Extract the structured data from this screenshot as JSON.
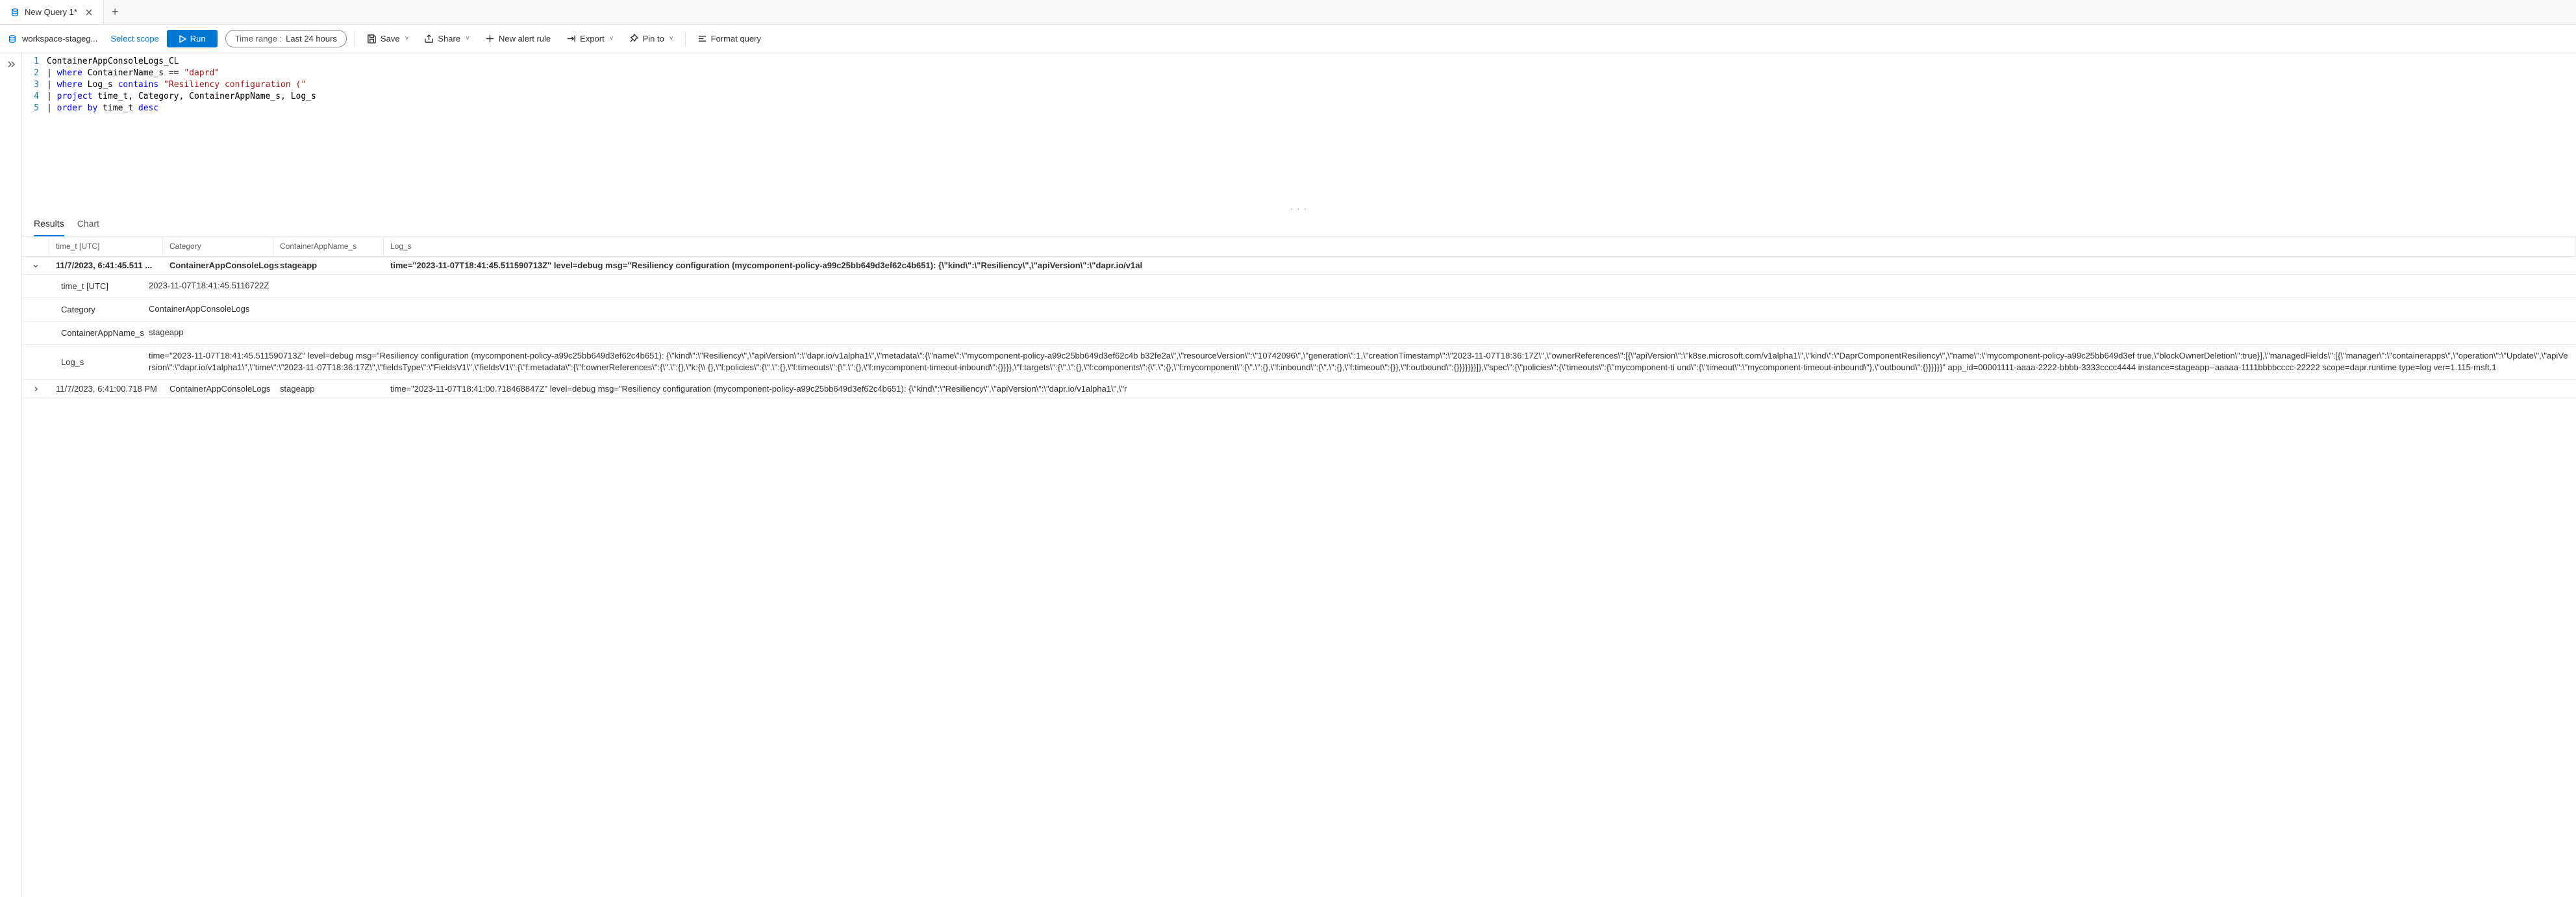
{
  "tab": {
    "title": "New Query 1*"
  },
  "workspace": {
    "name": "workspace-stageg...",
    "scope_link": "Select scope"
  },
  "toolbar": {
    "run": "Run",
    "timerange_label": "Time range :",
    "timerange_value": "Last 24 hours",
    "save": "Save",
    "share": "Share",
    "new_alert": "New alert rule",
    "export": "Export",
    "pin": "Pin to",
    "format": "Format query"
  },
  "editor": {
    "lines": [
      "ContainerAppConsoleLogs_CL",
      "| where ContainerName_s == \"daprd\"",
      "| where Log_s contains \"Resiliency configuration (\"",
      "| project time_t, Category, ContainerAppName_s, Log_s",
      "| order by time_t desc"
    ]
  },
  "result_tabs": {
    "results": "Results",
    "chart": "Chart"
  },
  "columns": {
    "time": "time_t [UTC]",
    "category": "Category",
    "appname": "ContainerAppName_s",
    "log": "Log_s"
  },
  "rows": [
    {
      "expanded": true,
      "time_display": "11/7/2023, 6:41:45.511 ...",
      "category": "ContainerAppConsoleLogs",
      "appname": "stageapp",
      "log_preview": "time=\"2023-11-07T18:41:45.511590713Z\" level=debug msg=\"Resiliency configuration (mycomponent-policy-a99c25bb649d3ef62c4b651): {\\\"kind\\\":\\\"Resiliency\\\",\\\"apiVersion\\\":\\\"dapr.io/v1al",
      "details": {
        "time_t": "2023-11-07T18:41:45.5116722Z",
        "category": "ContainerAppConsoleLogs",
        "appname": "stageapp",
        "log_full": "time=\"2023-11-07T18:41:45.511590713Z\" level=debug msg=\"Resiliency configuration (mycomponent-policy-a99c25bb649d3ef62c4b651): {\\\"kind\\\":\\\"Resiliency\\\",\\\"apiVersion\\\":\\\"dapr.io/v1alpha1\\\",\\\"metadata\\\":{\\\"name\\\":\\\"mycomponent-policy-a99c25bb649d3ef62c4b b32fe2a\\\",\\\"resourceVersion\\\":\\\"10742096\\\",\\\"generation\\\":1,\\\"creationTimestamp\\\":\\\"2023-11-07T18:36:17Z\\\",\\\"ownerReferences\\\":[{\\\"apiVersion\\\":\\\"k8se.microsoft.com/v1alpha1\\\",\\\"kind\\\":\\\"DaprComponentResiliency\\\",\\\"name\\\":\\\"mycomponent-policy-a99c25bb649d3ef true,\\\"blockOwnerDeletion\\\":true}],\\\"managedFields\\\":[{\\\"manager\\\":\\\"containerapps\\\",\\\"operation\\\":\\\"Update\\\",\\\"apiVersion\\\":\\\"dapr.io/v1alpha1\\\",\\\"time\\\":\\\"2023-11-07T18:36:17Z\\\",\\\"fieldsType\\\":\\\"FieldsV1\\\",\\\"fieldsV1\\\":{\\\"f:metadata\\\":{\\\"f:ownerReferences\\\":{\\\".\\\":{},\\\"k:{\\\\ {},\\\"f:policies\\\":{\\\".\\\":{},\\\"f:timeouts\\\":{\\\".\\\":{},\\\"f:mycomponent-timeout-inbound\\\":{}}}},\\\"f:targets\\\":{\\\".\\\":{},\\\"f:components\\\":{\\\".\\\":{},\\\"f:mycomponent\\\":{\\\".\\\":{},\\\"f:inbound\\\":{\\\".\\\":{},\\\"f:timeout\\\":{}},\\\"f:outbound\\\":{}}}}}}}]},\\\"spec\\\":{\\\"policies\\\":{\\\"timeouts\\\":{\\\"mycomponent-ti und\\\":{\\\"timeout\\\":\\\"mycomponent-timeout-inbound\\\"},\\\"outbound\\\":{}}}}}}\" app_id=00001111-aaaa-2222-bbbb-3333cccc4444 instance=stageapp--aaaaa-1111bbbbcccc-22222 scope=dapr.runtime type=log ver=1.115-msft.1"
      }
    },
    {
      "expanded": false,
      "time_display": "11/7/2023, 6:41:00.718 PM",
      "category": "ContainerAppConsoleLogs",
      "appname": "stageapp",
      "log_preview": "time=\"2023-11-07T18:41:00.718468847Z\" level=debug msg=\"Resiliency configuration (mycomponent-policy-a99c25bb649d3ef62c4b651): {\\\"kind\\\":\\\"Resiliency\\\",\\\"apiVersion\\\":\\\"dapr.io/v1alpha1\\\",\\\"r"
    }
  ],
  "chart_data": {}
}
